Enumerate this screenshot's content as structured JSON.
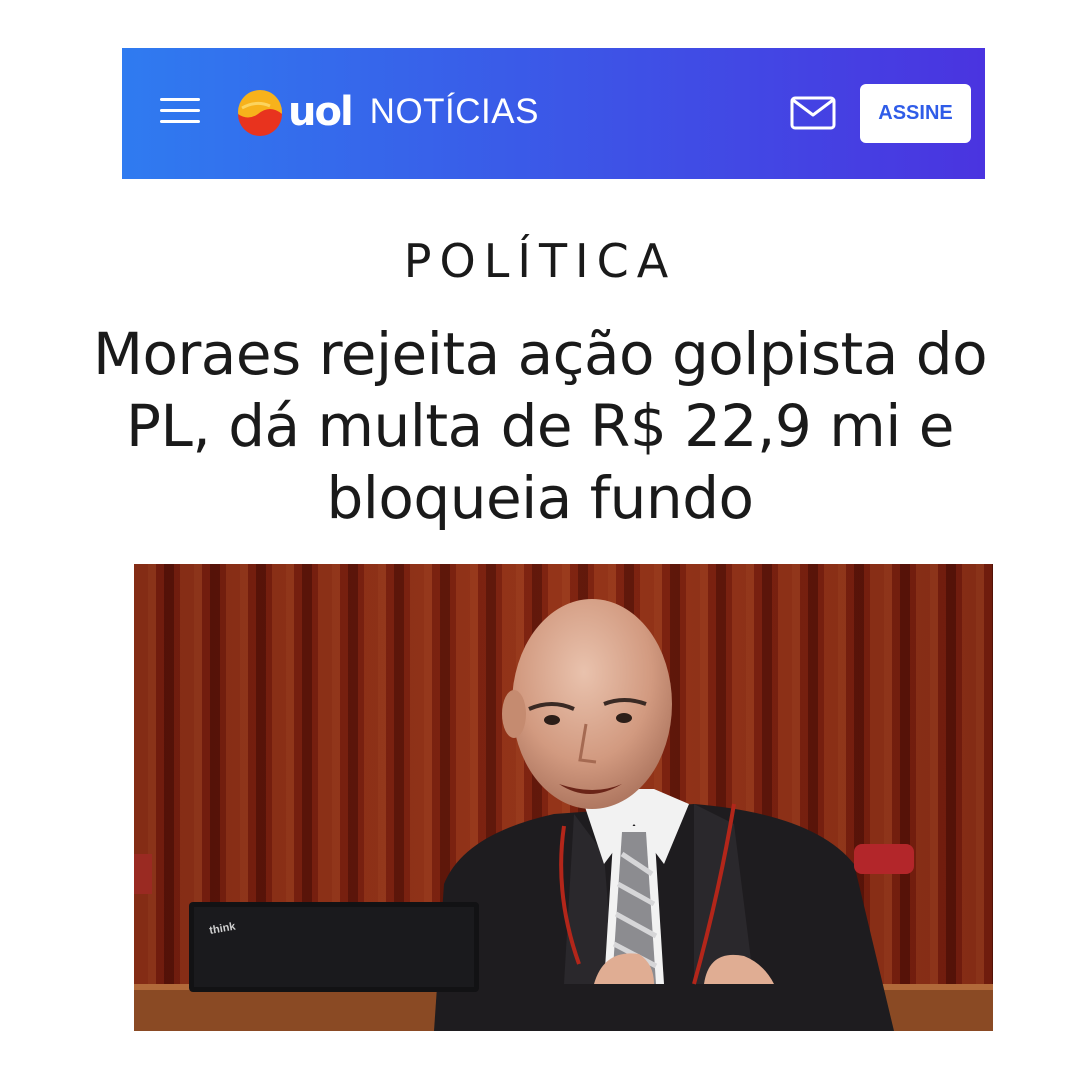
{
  "header": {
    "logo_text": "uol",
    "section_label": "NOTÍCIAS",
    "subscribe_label": "ASSINE",
    "menu_icon": "hamburger-menu-icon",
    "mail_icon": "mail-icon",
    "brand_color": "#3a5be8"
  },
  "article": {
    "category": "POLÍTICA",
    "headline_lines": [
      "Moraes rejeita ação golpista do",
      "PL, dá multa de R$ 22,9 mi e",
      "bloqueia fundo"
    ]
  },
  "photo": {
    "laptop_brand": "think"
  }
}
